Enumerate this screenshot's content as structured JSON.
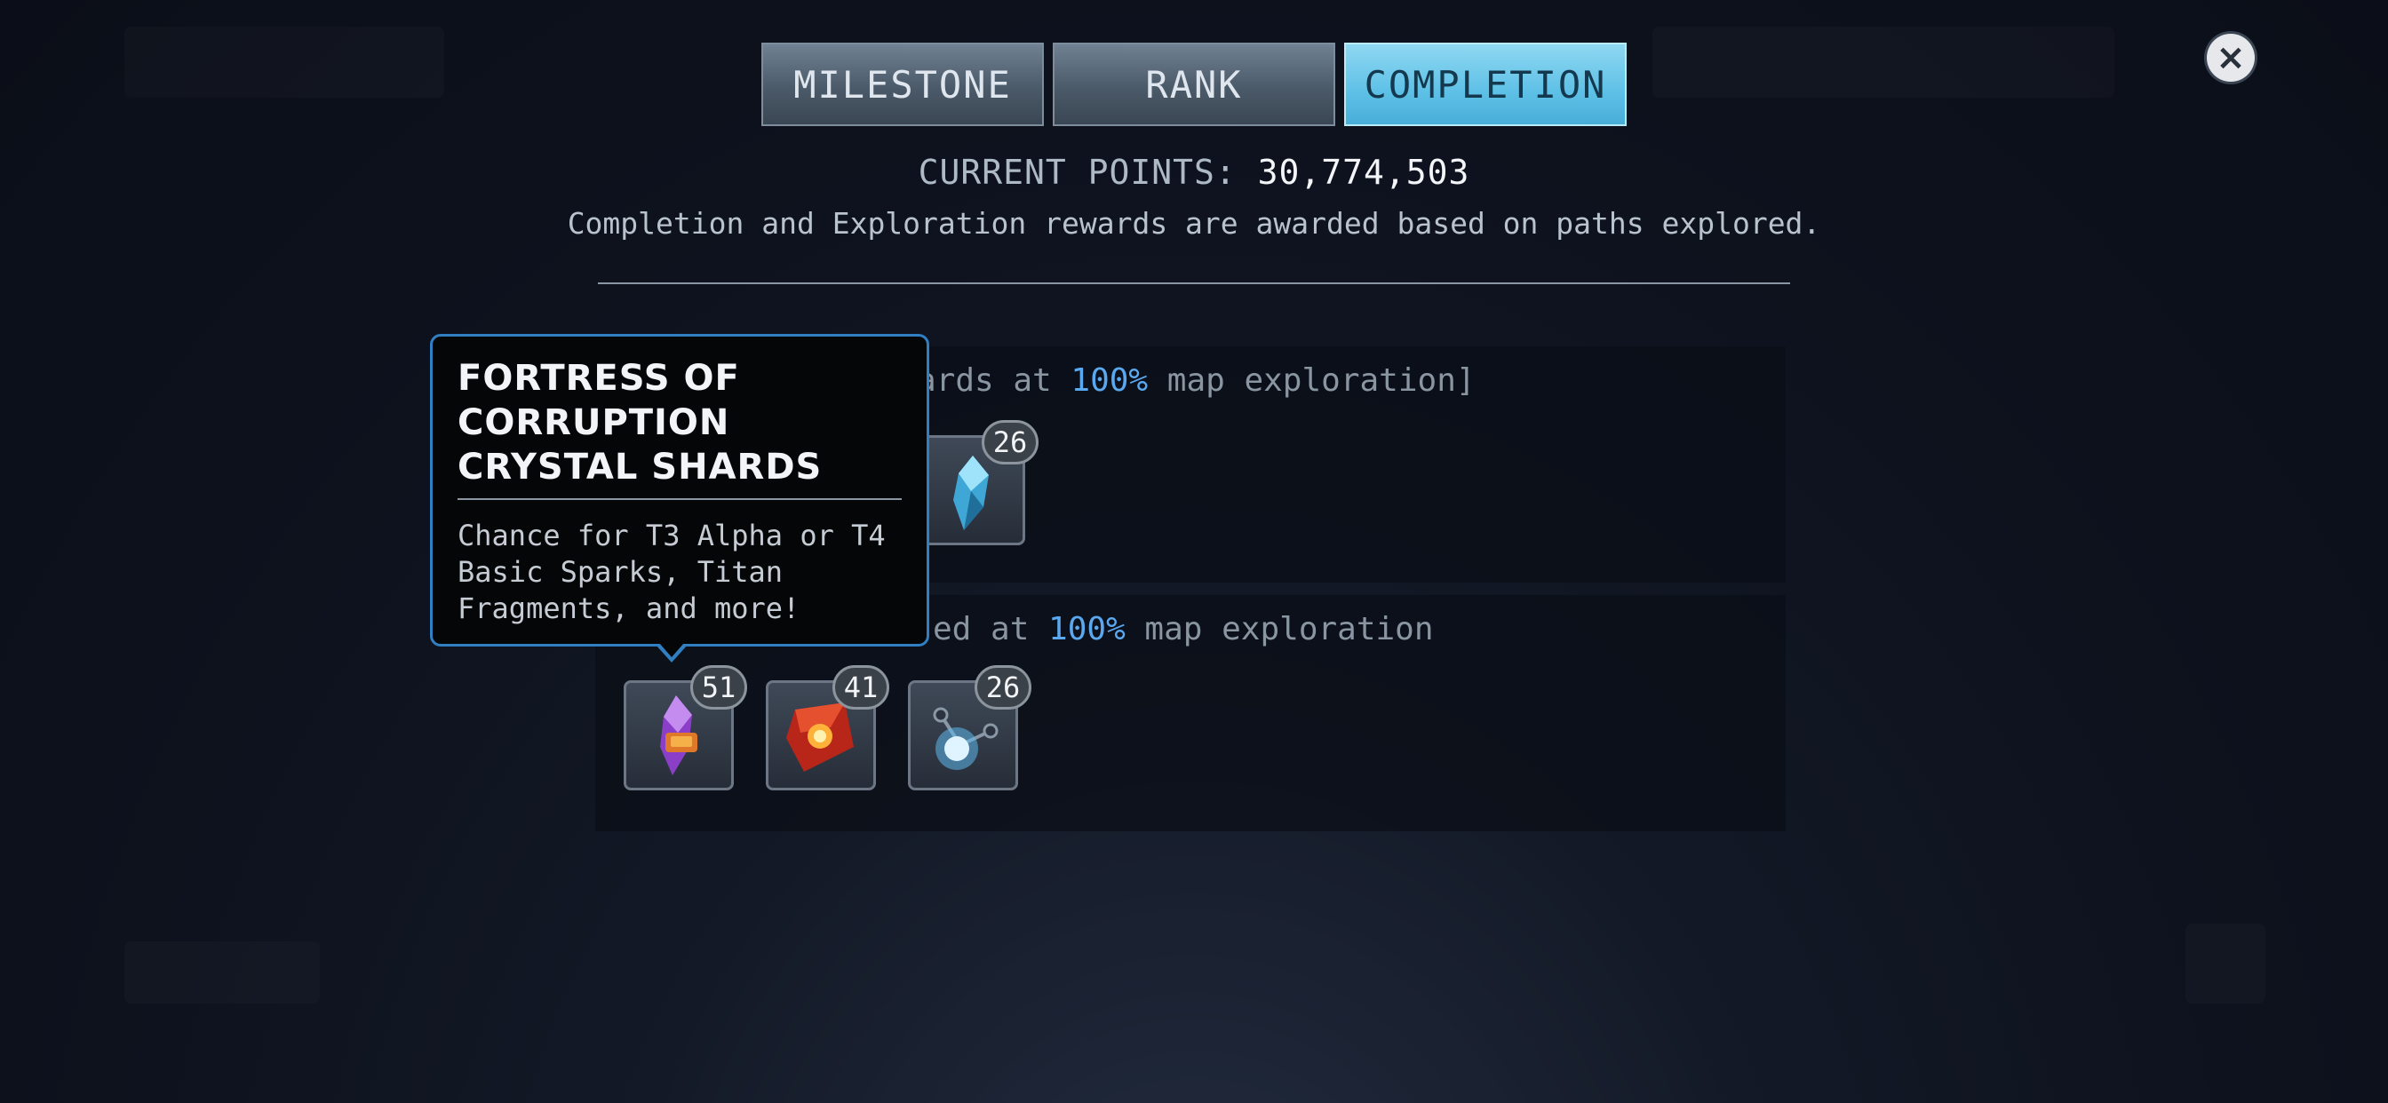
{
  "tabs": [
    {
      "label": "MILESTONE",
      "active": false
    },
    {
      "label": "RANK",
      "active": false
    },
    {
      "label": "COMPLETION",
      "active": true
    }
  ],
  "header": {
    "points_label": "CURRENT POINTS:",
    "points_value": "30,774,503",
    "subtitle": "Completion and Exploration rewards are awarded based on paths explored."
  },
  "sections": [
    {
      "label_prefix": "ards at ",
      "label_pct": "100%",
      "label_suffix": " map exploration]",
      "items": [
        {
          "icon": "crystal-shard-icon",
          "count": "26"
        }
      ]
    },
    {
      "label_prefix": "ed at ",
      "label_pct": "100%",
      "label_suffix": " map exploration",
      "items": [
        {
          "icon": "corruption-crystal-icon",
          "count": "51"
        },
        {
          "icon": "red-gem-icon",
          "count": "41"
        },
        {
          "icon": "energy-orb-icon",
          "count": "26"
        }
      ]
    }
  ],
  "tooltip": {
    "title": "FORTRESS OF CORRUPTION CRYSTAL SHARDS",
    "description": "Chance for T3 Alpha or T4 Basic Sparks, Titan Fragments, and more!"
  },
  "colors": {
    "accent": "#5aa9f0",
    "active_tab": "#5ec0e6",
    "tooltip_border": "#2f7fc2"
  }
}
